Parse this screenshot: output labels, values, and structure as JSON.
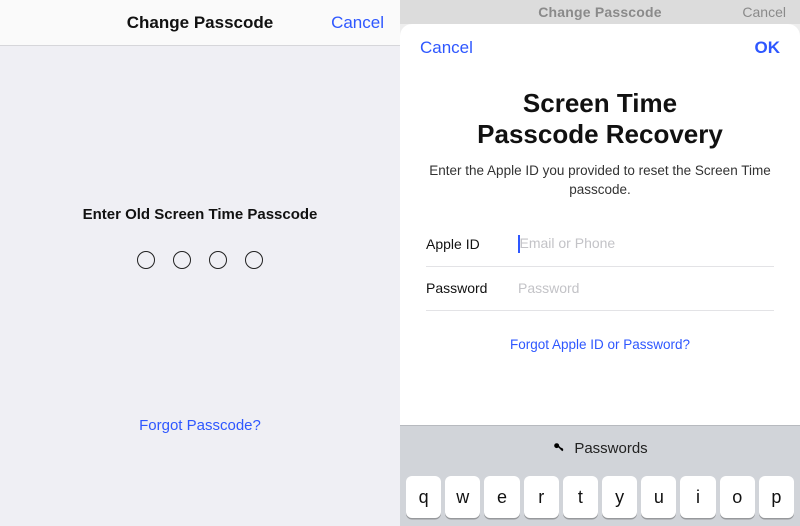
{
  "left": {
    "header": {
      "title": "Change Passcode",
      "cancel": "Cancel"
    },
    "prompt": "Enter Old Screen Time Passcode",
    "forgot": "Forgot Passcode?"
  },
  "right": {
    "bgheader": {
      "title": "Change Passcode",
      "cancel": "Cancel"
    },
    "modalHeader": {
      "cancel": "Cancel",
      "ok": "OK"
    },
    "hero": {
      "title1": "Screen Time",
      "title2": "Passcode Recovery",
      "sub": "Enter the Apple ID you provided to reset the Screen Time passcode."
    },
    "form": {
      "appleId": {
        "label": "Apple ID",
        "placeholder": "Email or Phone",
        "value": ""
      },
      "password": {
        "label": "Password",
        "placeholder": "Password",
        "value": ""
      }
    },
    "forgot": "Forgot Apple ID or Password?",
    "kbd": {
      "barLabel": "Passwords",
      "keys": [
        "q",
        "w",
        "e",
        "r",
        "t",
        "y",
        "u",
        "i",
        "o",
        "p"
      ]
    }
  }
}
